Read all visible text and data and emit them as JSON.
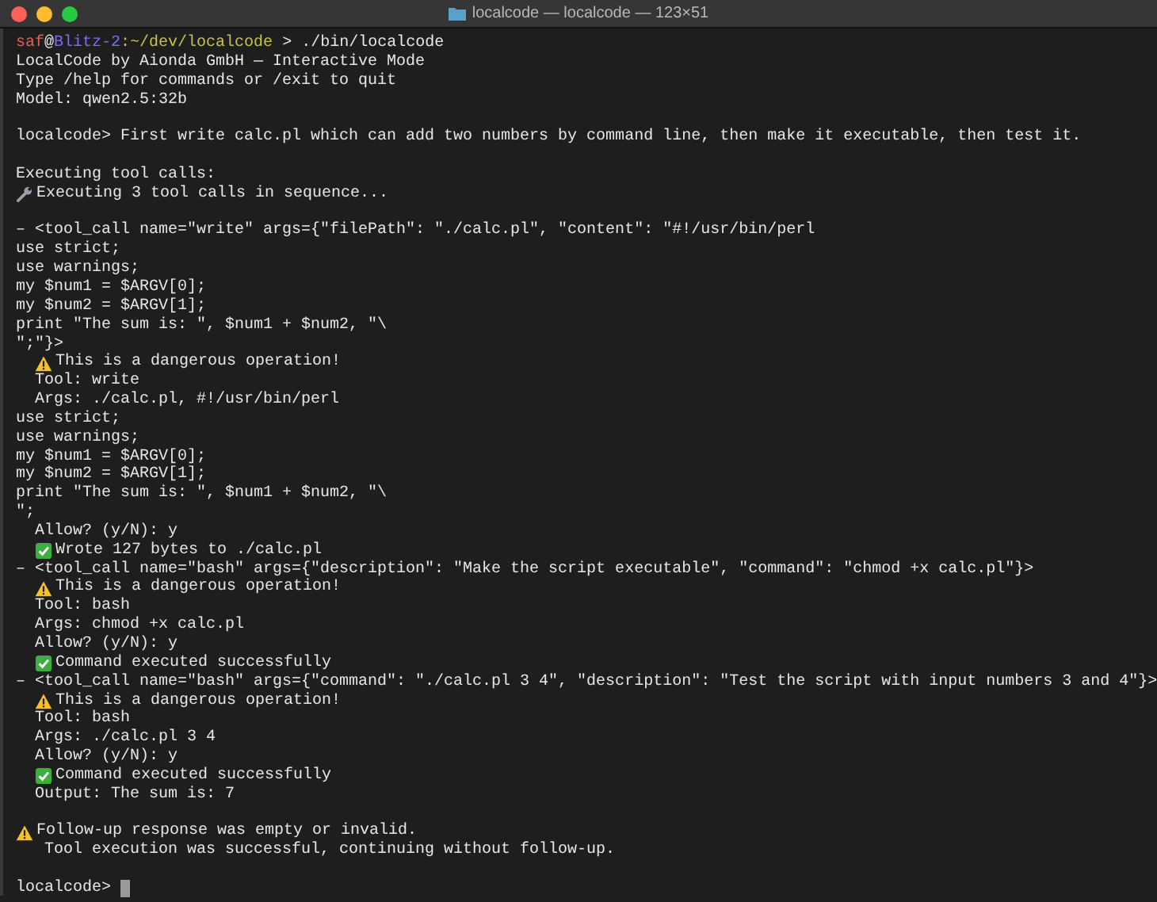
{
  "window": {
    "title": "localcode — localcode — 123×51"
  },
  "lines": [
    {
      "kind": "shell_prompt",
      "segments": [
        {
          "text": "saf",
          "color": "#e0605a"
        },
        {
          "text": "@",
          "color": "#e6e6e6"
        },
        {
          "text": "Blitz-2",
          "color": "#7b6cf0"
        },
        {
          "text": ":~/dev/localcode",
          "color": "#c8c04a"
        },
        {
          "text": " > ./bin/localcode",
          "color": "#e6e6e6"
        }
      ]
    },
    {
      "kind": "plain",
      "text": "LocalCode by Aionda GmbH — Interactive Mode"
    },
    {
      "kind": "plain",
      "text": "Type /help for commands or /exit to quit"
    },
    {
      "kind": "plain",
      "text": "Model: qwen2.5:32b"
    },
    {
      "kind": "blank"
    },
    {
      "kind": "plain",
      "text": "localcode> First write calc.pl which can add two numbers by command line, then make it executable, then test it."
    },
    {
      "kind": "blank"
    },
    {
      "kind": "plain",
      "text": "Executing tool calls:"
    },
    {
      "kind": "tool",
      "indented": false,
      "text": "Executing 3 tool calls in sequence..."
    },
    {
      "kind": "blank"
    },
    {
      "kind": "plain",
      "text": "– <tool_call name=\"write\" args={\"filePath\": \"./calc.pl\", \"content\": \"#!/usr/bin/perl"
    },
    {
      "kind": "plain",
      "text": "use strict;"
    },
    {
      "kind": "plain",
      "text": "use warnings;"
    },
    {
      "kind": "plain",
      "text": "my $num1 = $ARGV[0];"
    },
    {
      "kind": "plain",
      "text": "my $num2 = $ARGV[1];"
    },
    {
      "kind": "plain",
      "text": "print \"The sum is: \", $num1 + $num2, \"\\"
    },
    {
      "kind": "plain",
      "text": "\";\"}>"
    },
    {
      "kind": "warning",
      "indented": true,
      "text": "This is a dangerous operation!"
    },
    {
      "kind": "plain",
      "text": "  Tool: write"
    },
    {
      "kind": "plain",
      "text": "  Args: ./calc.pl, #!/usr/bin/perl"
    },
    {
      "kind": "plain",
      "text": "use strict;"
    },
    {
      "kind": "plain",
      "text": "use warnings;"
    },
    {
      "kind": "plain",
      "text": "my $num1 = $ARGV[0];"
    },
    {
      "kind": "plain",
      "text": "my $num2 = $ARGV[1];"
    },
    {
      "kind": "plain",
      "text": "print \"The sum is: \", $num1 + $num2, \"\\"
    },
    {
      "kind": "plain",
      "text": "\";"
    },
    {
      "kind": "plain",
      "text": "  Allow? (y/N): y"
    },
    {
      "kind": "success",
      "indented": true,
      "text": "Wrote 127 bytes to ./calc.pl"
    },
    {
      "kind": "plain",
      "text": "– <tool_call name=\"bash\" args={\"description\": \"Make the script executable\", \"command\": \"chmod +x calc.pl\"}>"
    },
    {
      "kind": "warning",
      "indented": true,
      "text": "This is a dangerous operation!"
    },
    {
      "kind": "plain",
      "text": "  Tool: bash"
    },
    {
      "kind": "plain",
      "text": "  Args: chmod +x calc.pl"
    },
    {
      "kind": "plain",
      "text": "  Allow? (y/N): y"
    },
    {
      "kind": "success",
      "indented": true,
      "text": "Command executed successfully"
    },
    {
      "kind": "plain",
      "text": "– <tool_call name=\"bash\" args={\"command\": \"./calc.pl 3 4\", \"description\": \"Test the script with input numbers 3 and 4\"}>"
    },
    {
      "kind": "warning",
      "indented": true,
      "text": "This is a dangerous operation!"
    },
    {
      "kind": "plain",
      "text": "  Tool: bash"
    },
    {
      "kind": "plain",
      "text": "  Args: ./calc.pl 3 4"
    },
    {
      "kind": "plain",
      "text": "  Allow? (y/N): y"
    },
    {
      "kind": "success",
      "indented": true,
      "text": "Command executed successfully"
    },
    {
      "kind": "plain",
      "text": "  Output: The sum is: 7"
    },
    {
      "kind": "blank"
    },
    {
      "kind": "warning",
      "indented": false,
      "text": "Follow-up response was empty or invalid."
    },
    {
      "kind": "plain",
      "text": "   Tool execution was successful, continuing without follow-up."
    },
    {
      "kind": "blank"
    },
    {
      "kind": "input_prompt",
      "text": "localcode>"
    }
  ]
}
